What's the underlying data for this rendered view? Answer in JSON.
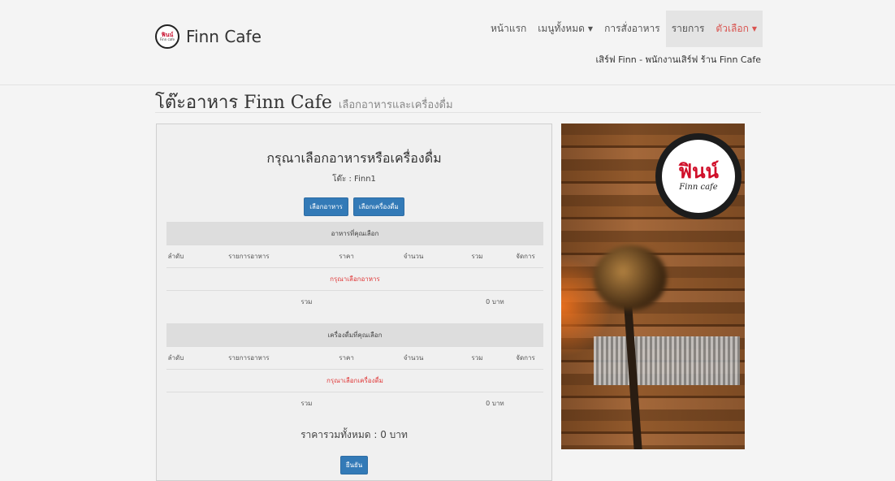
{
  "brand": {
    "name": "Finn Cafe",
    "logo_text": "ฟินน์",
    "logo_sub": "Finn cafe"
  },
  "nav": {
    "items": [
      {
        "label": "หน้าแรก",
        "caret": false,
        "active": false
      },
      {
        "label": "เมนูทั้งหมด",
        "caret": true,
        "active": false
      },
      {
        "label": "การสั่งอาหาร",
        "caret": false,
        "active": false
      },
      {
        "label": "รายการ",
        "caret": false,
        "active": true
      },
      {
        "label": "ตัวเลือก",
        "caret": true,
        "active": true
      }
    ],
    "staff": "เสิร์ฟ Finn - พนักงานเสิร์ฟ ร้าน Finn Cafe"
  },
  "page": {
    "title": "โต๊ะอาหาร Finn Cafe",
    "subtitle": "เลือกอาหารและเครื่องดื่ม"
  },
  "order": {
    "prompt": "กรุณาเลือกอาหารหรือเครื่องดื่ม",
    "table_label": "โต๊ะ : Finn1",
    "btn_food": "เลือกอาหาร",
    "btn_drink": "เลือกเครื่องดื่ม",
    "food": {
      "caption": "อาหารที่คุณเลือก",
      "headers": [
        "ลำดับ",
        "รายการอาหาร",
        "ราคา",
        "จำนวน",
        "รวม",
        "จัดการ"
      ],
      "empty": "กรุณาเลือกอาหาร",
      "total_label": "รวม",
      "total_value": "0 บาท"
    },
    "drink": {
      "caption": "เครื่องดื่มที่คุณเลือก",
      "headers": [
        "ลำดับ",
        "รายการอาหาร",
        "ราคา",
        "จำนวน",
        "รวม",
        "จัดการ"
      ],
      "empty": "กรุณาเลือกเครื่องดื่ม",
      "total_label": "รวม",
      "total_value": "0 บาท"
    },
    "grand_total": "ราคารวมทั้งหมด : 0 บาท",
    "confirm": "ยืนยัน"
  },
  "photo": {
    "badge_main": "ฟินน์",
    "badge_sub": "Finn cafe"
  },
  "colors": {
    "primary": "#337ab7",
    "danger": "#d9534f",
    "empty_text": "#e03a3a"
  }
}
